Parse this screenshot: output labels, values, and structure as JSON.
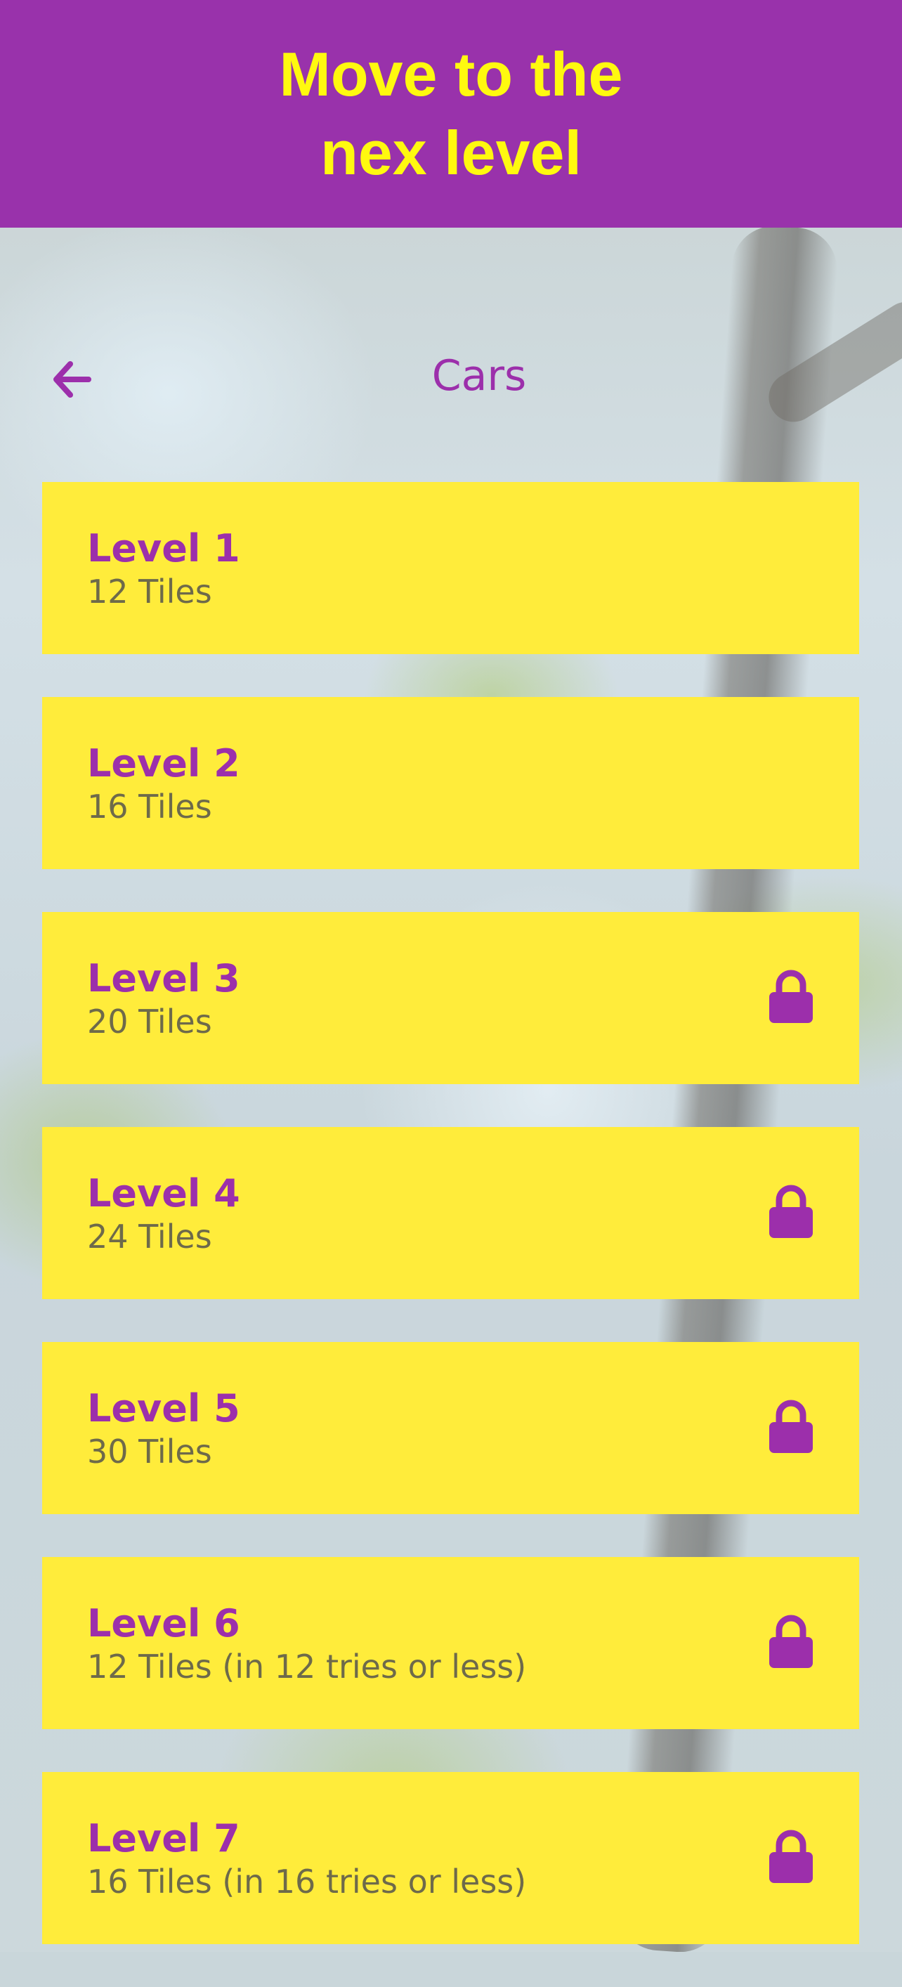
{
  "header": {
    "title": "Move to the\nnex level"
  },
  "nav": {
    "back_icon": "arrow-left-icon",
    "title": "Cars"
  },
  "colors": {
    "header_bg": "#9932ab",
    "header_text": "#fff90f",
    "card_bg": "#ffec3b",
    "accent": "#9c2fab",
    "subtext": "#6e6a4a"
  },
  "levels": [
    {
      "title": "Level 1",
      "subtitle": "12 Tiles",
      "locked": false
    },
    {
      "title": "Level 2",
      "subtitle": "16 Tiles",
      "locked": false
    },
    {
      "title": "Level 3",
      "subtitle": "20 Tiles",
      "locked": true,
      "icon": "lock-icon"
    },
    {
      "title": "Level 4",
      "subtitle": "24 Tiles",
      "locked": true,
      "icon": "lock-icon"
    },
    {
      "title": "Level 5",
      "subtitle": "30 Tiles",
      "locked": true,
      "icon": "lock-icon"
    },
    {
      "title": "Level 6",
      "subtitle": "12 Tiles (in 12 tries or less)",
      "locked": true,
      "icon": "lock-icon"
    },
    {
      "title": "Level 7",
      "subtitle": "16 Tiles (in 16 tries or less)",
      "locked": true,
      "icon": "lock-icon"
    }
  ]
}
